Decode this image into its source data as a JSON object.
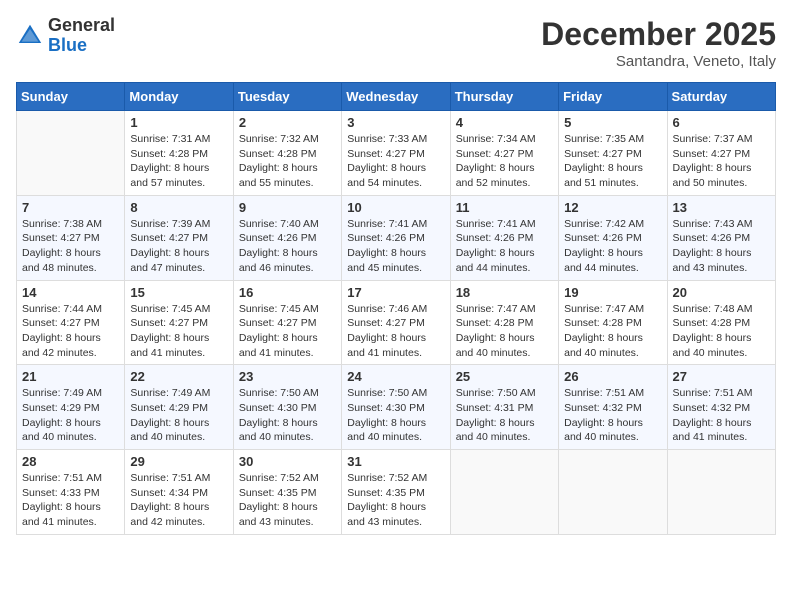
{
  "header": {
    "logo_general": "General",
    "logo_blue": "Blue",
    "month_title": "December 2025",
    "subtitle": "Santandra, Veneto, Italy"
  },
  "days_of_week": [
    "Sunday",
    "Monday",
    "Tuesday",
    "Wednesday",
    "Thursday",
    "Friday",
    "Saturday"
  ],
  "weeks": [
    [
      {
        "day": "",
        "sunrise": "",
        "sunset": "",
        "daylight": ""
      },
      {
        "day": "1",
        "sunrise": "Sunrise: 7:31 AM",
        "sunset": "Sunset: 4:28 PM",
        "daylight": "Daylight: 8 hours and 57 minutes."
      },
      {
        "day": "2",
        "sunrise": "Sunrise: 7:32 AM",
        "sunset": "Sunset: 4:28 PM",
        "daylight": "Daylight: 8 hours and 55 minutes."
      },
      {
        "day": "3",
        "sunrise": "Sunrise: 7:33 AM",
        "sunset": "Sunset: 4:27 PM",
        "daylight": "Daylight: 8 hours and 54 minutes."
      },
      {
        "day": "4",
        "sunrise": "Sunrise: 7:34 AM",
        "sunset": "Sunset: 4:27 PM",
        "daylight": "Daylight: 8 hours and 52 minutes."
      },
      {
        "day": "5",
        "sunrise": "Sunrise: 7:35 AM",
        "sunset": "Sunset: 4:27 PM",
        "daylight": "Daylight: 8 hours and 51 minutes."
      },
      {
        "day": "6",
        "sunrise": "Sunrise: 7:37 AM",
        "sunset": "Sunset: 4:27 PM",
        "daylight": "Daylight: 8 hours and 50 minutes."
      }
    ],
    [
      {
        "day": "7",
        "sunrise": "Sunrise: 7:38 AM",
        "sunset": "Sunset: 4:27 PM",
        "daylight": "Daylight: 8 hours and 48 minutes."
      },
      {
        "day": "8",
        "sunrise": "Sunrise: 7:39 AM",
        "sunset": "Sunset: 4:27 PM",
        "daylight": "Daylight: 8 hours and 47 minutes."
      },
      {
        "day": "9",
        "sunrise": "Sunrise: 7:40 AM",
        "sunset": "Sunset: 4:26 PM",
        "daylight": "Daylight: 8 hours and 46 minutes."
      },
      {
        "day": "10",
        "sunrise": "Sunrise: 7:41 AM",
        "sunset": "Sunset: 4:26 PM",
        "daylight": "Daylight: 8 hours and 45 minutes."
      },
      {
        "day": "11",
        "sunrise": "Sunrise: 7:41 AM",
        "sunset": "Sunset: 4:26 PM",
        "daylight": "Daylight: 8 hours and 44 minutes."
      },
      {
        "day": "12",
        "sunrise": "Sunrise: 7:42 AM",
        "sunset": "Sunset: 4:26 PM",
        "daylight": "Daylight: 8 hours and 44 minutes."
      },
      {
        "day": "13",
        "sunrise": "Sunrise: 7:43 AM",
        "sunset": "Sunset: 4:26 PM",
        "daylight": "Daylight: 8 hours and 43 minutes."
      }
    ],
    [
      {
        "day": "14",
        "sunrise": "Sunrise: 7:44 AM",
        "sunset": "Sunset: 4:27 PM",
        "daylight": "Daylight: 8 hours and 42 minutes."
      },
      {
        "day": "15",
        "sunrise": "Sunrise: 7:45 AM",
        "sunset": "Sunset: 4:27 PM",
        "daylight": "Daylight: 8 hours and 41 minutes."
      },
      {
        "day": "16",
        "sunrise": "Sunrise: 7:45 AM",
        "sunset": "Sunset: 4:27 PM",
        "daylight": "Daylight: 8 hours and 41 minutes."
      },
      {
        "day": "17",
        "sunrise": "Sunrise: 7:46 AM",
        "sunset": "Sunset: 4:27 PM",
        "daylight": "Daylight: 8 hours and 41 minutes."
      },
      {
        "day": "18",
        "sunrise": "Sunrise: 7:47 AM",
        "sunset": "Sunset: 4:28 PM",
        "daylight": "Daylight: 8 hours and 40 minutes."
      },
      {
        "day": "19",
        "sunrise": "Sunrise: 7:47 AM",
        "sunset": "Sunset: 4:28 PM",
        "daylight": "Daylight: 8 hours and 40 minutes."
      },
      {
        "day": "20",
        "sunrise": "Sunrise: 7:48 AM",
        "sunset": "Sunset: 4:28 PM",
        "daylight": "Daylight: 8 hours and 40 minutes."
      }
    ],
    [
      {
        "day": "21",
        "sunrise": "Sunrise: 7:49 AM",
        "sunset": "Sunset: 4:29 PM",
        "daylight": "Daylight: 8 hours and 40 minutes."
      },
      {
        "day": "22",
        "sunrise": "Sunrise: 7:49 AM",
        "sunset": "Sunset: 4:29 PM",
        "daylight": "Daylight: 8 hours and 40 minutes."
      },
      {
        "day": "23",
        "sunrise": "Sunrise: 7:50 AM",
        "sunset": "Sunset: 4:30 PM",
        "daylight": "Daylight: 8 hours and 40 minutes."
      },
      {
        "day": "24",
        "sunrise": "Sunrise: 7:50 AM",
        "sunset": "Sunset: 4:30 PM",
        "daylight": "Daylight: 8 hours and 40 minutes."
      },
      {
        "day": "25",
        "sunrise": "Sunrise: 7:50 AM",
        "sunset": "Sunset: 4:31 PM",
        "daylight": "Daylight: 8 hours and 40 minutes."
      },
      {
        "day": "26",
        "sunrise": "Sunrise: 7:51 AM",
        "sunset": "Sunset: 4:32 PM",
        "daylight": "Daylight: 8 hours and 40 minutes."
      },
      {
        "day": "27",
        "sunrise": "Sunrise: 7:51 AM",
        "sunset": "Sunset: 4:32 PM",
        "daylight": "Daylight: 8 hours and 41 minutes."
      }
    ],
    [
      {
        "day": "28",
        "sunrise": "Sunrise: 7:51 AM",
        "sunset": "Sunset: 4:33 PM",
        "daylight": "Daylight: 8 hours and 41 minutes."
      },
      {
        "day": "29",
        "sunrise": "Sunrise: 7:51 AM",
        "sunset": "Sunset: 4:34 PM",
        "daylight": "Daylight: 8 hours and 42 minutes."
      },
      {
        "day": "30",
        "sunrise": "Sunrise: 7:52 AM",
        "sunset": "Sunset: 4:35 PM",
        "daylight": "Daylight: 8 hours and 43 minutes."
      },
      {
        "day": "31",
        "sunrise": "Sunrise: 7:52 AM",
        "sunset": "Sunset: 4:35 PM",
        "daylight": "Daylight: 8 hours and 43 minutes."
      },
      {
        "day": "",
        "sunrise": "",
        "sunset": "",
        "daylight": ""
      },
      {
        "day": "",
        "sunrise": "",
        "sunset": "",
        "daylight": ""
      },
      {
        "day": "",
        "sunrise": "",
        "sunset": "",
        "daylight": ""
      }
    ]
  ]
}
